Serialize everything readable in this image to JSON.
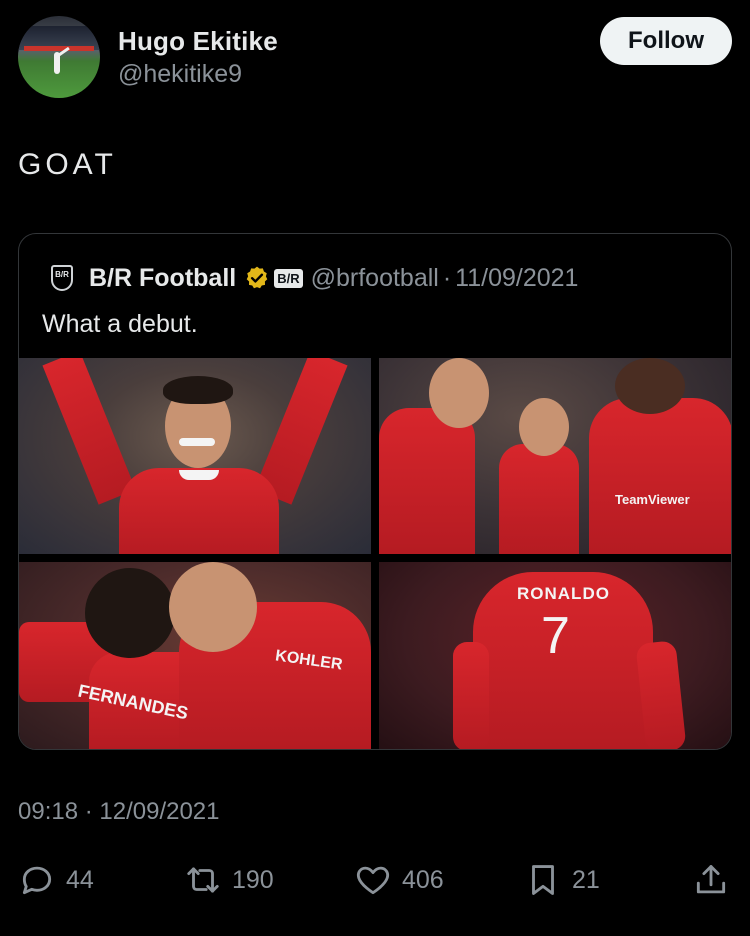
{
  "author": {
    "name": "Hugo Ekitike",
    "handle": "@hekitike9",
    "follow_label": "Follow"
  },
  "tweet": {
    "text": "GOAT",
    "timestamp": "09:18 · 12/09/2021"
  },
  "quoted": {
    "logo_text": "B/R",
    "name": "B/R Football",
    "badge_text": "B/R",
    "handle": "@brfootball",
    "separator": "·",
    "date": "11/09/2021",
    "text": "What a debut.",
    "photos": [
      {
        "icon": "celebration-photo"
      },
      {
        "icon": "teammates-photo",
        "sponsor_text": "TeamViewer"
      },
      {
        "icon": "hug-photo",
        "sponsor_text": "KOHLER",
        "shirt_text": "FERNANDES"
      },
      {
        "icon": "shirt-back-photo",
        "shirt_name": "RONALDO",
        "shirt_number": "7"
      }
    ]
  },
  "actions": {
    "replies": "44",
    "retweets": "190",
    "likes": "406",
    "bookmarks": "21"
  },
  "colors": {
    "background": "#000000",
    "text": "#e7e9ea",
    "muted": "#8b9299",
    "border": "#333639",
    "verified_gold": "#e2b719",
    "united_red": "#d8262c"
  }
}
